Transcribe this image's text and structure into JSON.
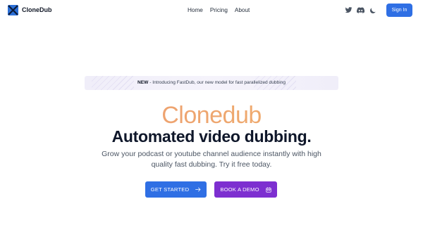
{
  "header": {
    "logo_text": "CloneDub",
    "nav": [
      {
        "label": "Home"
      },
      {
        "label": "Pricing"
      },
      {
        "label": "About"
      }
    ],
    "icons": [
      "twitter-icon",
      "discord-icon",
      "moon-icon"
    ],
    "signin_label": "Sign In"
  },
  "banner": {
    "tag": "NEW",
    "text": " - Introducing FastDub, our new model for fast parallelized dubbing"
  },
  "hero": {
    "brand": "Clonedub",
    "headline": "Automated video dubbing.",
    "subtitle": "Grow your podcast or youtube channel audience instantly with high quality fast dubbing. Try it free today.",
    "cta_primary": "GET STARTED",
    "cta_secondary": "BOOK A DEMO"
  },
  "colors": {
    "primary": "#2f6fe4",
    "secondary": "#7d2fd0",
    "brand_gradient_start": "#ef9a76",
    "brand_gradient_end": "#f2b56b"
  }
}
